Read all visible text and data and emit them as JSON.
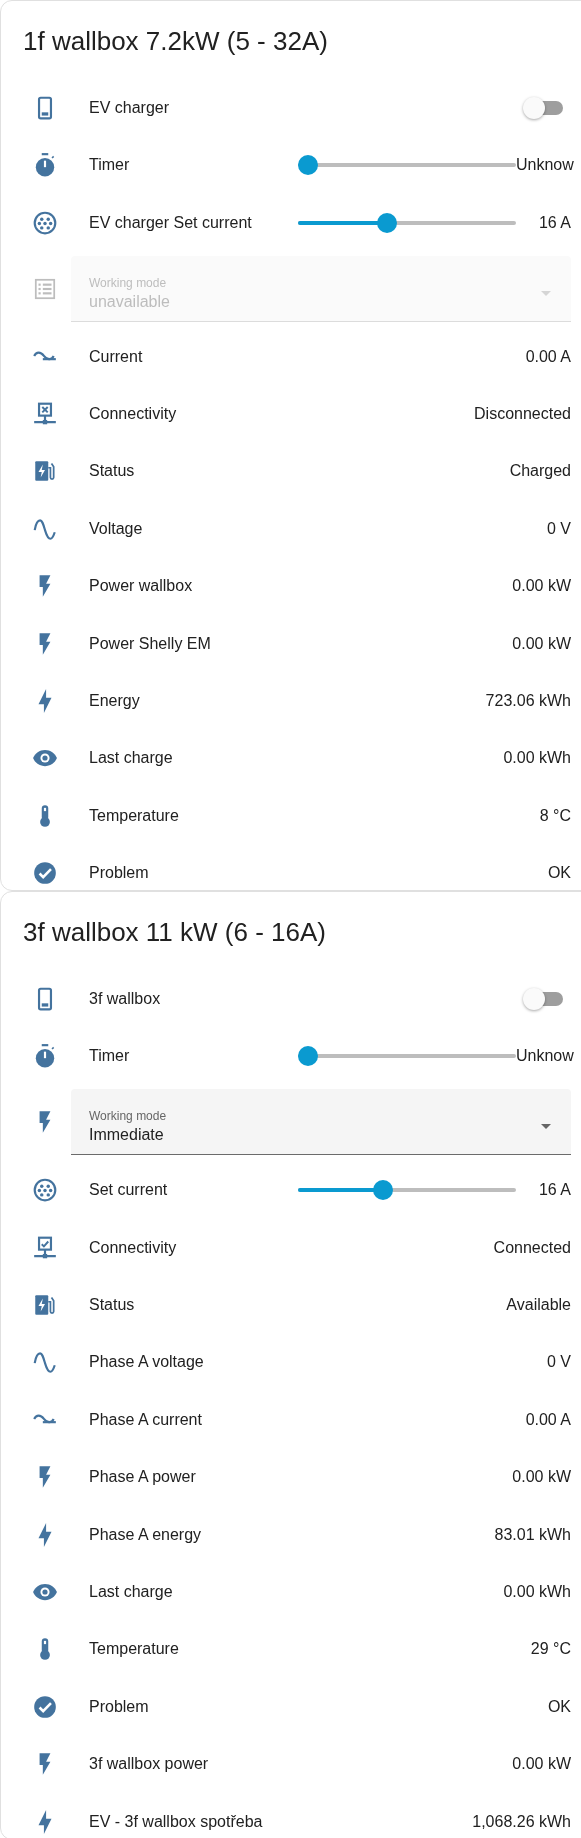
{
  "cards": [
    {
      "title": "1f wallbox 7.2kW (5 - 32A)",
      "rows": [
        {
          "kind": "toggle",
          "label": "EV charger",
          "on": false
        },
        {
          "kind": "slider",
          "label": "Timer",
          "level": 0,
          "value": "Unknow"
        },
        {
          "kind": "slider",
          "label": "EV charger Set current",
          "level": 0.4,
          "value": "16 A"
        },
        {
          "kind": "select",
          "label": "Working mode",
          "value": "unavailable",
          "disabled": true
        },
        {
          "kind": "sensor",
          "label": "Current",
          "value": "0.00 A"
        },
        {
          "kind": "sensor",
          "label": "Connectivity",
          "value": "Disconnected"
        },
        {
          "kind": "sensor",
          "label": "Status",
          "value": "Charged"
        },
        {
          "kind": "sensor",
          "label": "Voltage",
          "value": "0 V"
        },
        {
          "kind": "sensor",
          "label": "Power wallbox",
          "value": "0.00 kW"
        },
        {
          "kind": "sensor",
          "label": "Power Shelly EM",
          "value": "0.00 kW"
        },
        {
          "kind": "sensor",
          "label": "Energy",
          "value": "723.06 kWh"
        },
        {
          "kind": "sensor",
          "label": "Last charge",
          "value": "0.00 kWh"
        },
        {
          "kind": "sensor",
          "label": "Temperature",
          "value": "8 °C"
        },
        {
          "kind": "sensor",
          "label": "Problem",
          "value": "OK"
        }
      ]
    },
    {
      "title": "3f wallbox 11 kW (6 - 16A)",
      "rows": [
        {
          "kind": "toggle",
          "label": "3f wallbox",
          "on": false
        },
        {
          "kind": "slider",
          "label": "Timer",
          "level": 0,
          "value": "Unknow"
        },
        {
          "kind": "select",
          "label": "Working mode",
          "value": "Immediate",
          "disabled": false
        },
        {
          "kind": "slider",
          "label": "Set current",
          "level": 0.38,
          "value": "16 A"
        },
        {
          "kind": "sensor",
          "label": "Connectivity",
          "value": "Connected"
        },
        {
          "kind": "sensor",
          "label": "Status",
          "value": "Available"
        },
        {
          "kind": "sensor",
          "label": "Phase A voltage",
          "value": "0 V"
        },
        {
          "kind": "sensor",
          "label": "Phase A current",
          "value": "0.00 A"
        },
        {
          "kind": "sensor",
          "label": "Phase A power",
          "value": "0.00 kW"
        },
        {
          "kind": "sensor",
          "label": "Phase A energy",
          "value": "83.01 kWh"
        },
        {
          "kind": "sensor",
          "label": "Last charge",
          "value": "0.00 kWh"
        },
        {
          "kind": "sensor",
          "label": "Temperature",
          "value": "29 °C"
        },
        {
          "kind": "sensor",
          "label": "Problem",
          "value": "OK"
        },
        {
          "kind": "sensor",
          "label": "3f wallbox power",
          "value": "0.00 kW"
        },
        {
          "kind": "sensor",
          "label": "EV - 3f wallbox spotřeba",
          "value": "1,068.26 kWh"
        }
      ]
    }
  ]
}
